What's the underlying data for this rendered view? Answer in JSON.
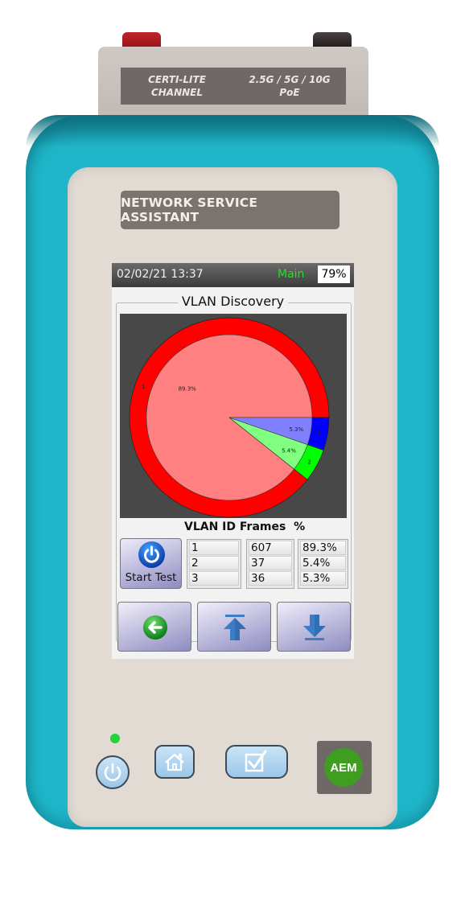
{
  "device": {
    "adapter_label_left": [
      "CERTI-LITE",
      "CHANNEL"
    ],
    "adapter_label_right": [
      "2.5G / 5G / 10G",
      "PoE"
    ],
    "brand_label": "NETWORK SERVICE ASSISTANT",
    "logo_text": "AEM",
    "led_color": "#22d33a",
    "boot_color": "#1fb6c9"
  },
  "status_bar": {
    "datetime": "02/02/21 13:37",
    "mode": "Main",
    "mode_color": "#22e022",
    "battery": "79%"
  },
  "screen": {
    "title": "VLAN Discovery",
    "table_header": "VLAN ID Frames  %",
    "start_button_label": "Start Test",
    "table": {
      "columns": [
        "VLAN ID",
        "Frames",
        "%"
      ],
      "rows": [
        {
          "vlan_id": "1",
          "frames": "607",
          "percent": "89.3%"
        },
        {
          "vlan_id": "2",
          "frames": "37",
          "percent": "5.4%"
        },
        {
          "vlan_id": "3",
          "frames": "36",
          "percent": "5.3%"
        }
      ]
    },
    "nav_buttons": [
      "back",
      "scroll-top",
      "scroll-down"
    ]
  },
  "chart_data": {
    "type": "pie",
    "title": "VLAN Discovery",
    "labels": [
      "1",
      "2",
      "3"
    ],
    "values": [
      89.3,
      5.4,
      5.3
    ],
    "value_labels": [
      "89.3%",
      "5.4%",
      "5.3%"
    ],
    "outer_colors": [
      "#ff0000",
      "#00ff00",
      "#0000ff"
    ],
    "inner_colors": [
      "#ff8080",
      "#80ff80",
      "#8080ff"
    ],
    "start_angle_deg": 0,
    "direction": "counterclockwise",
    "background": "#484848"
  }
}
